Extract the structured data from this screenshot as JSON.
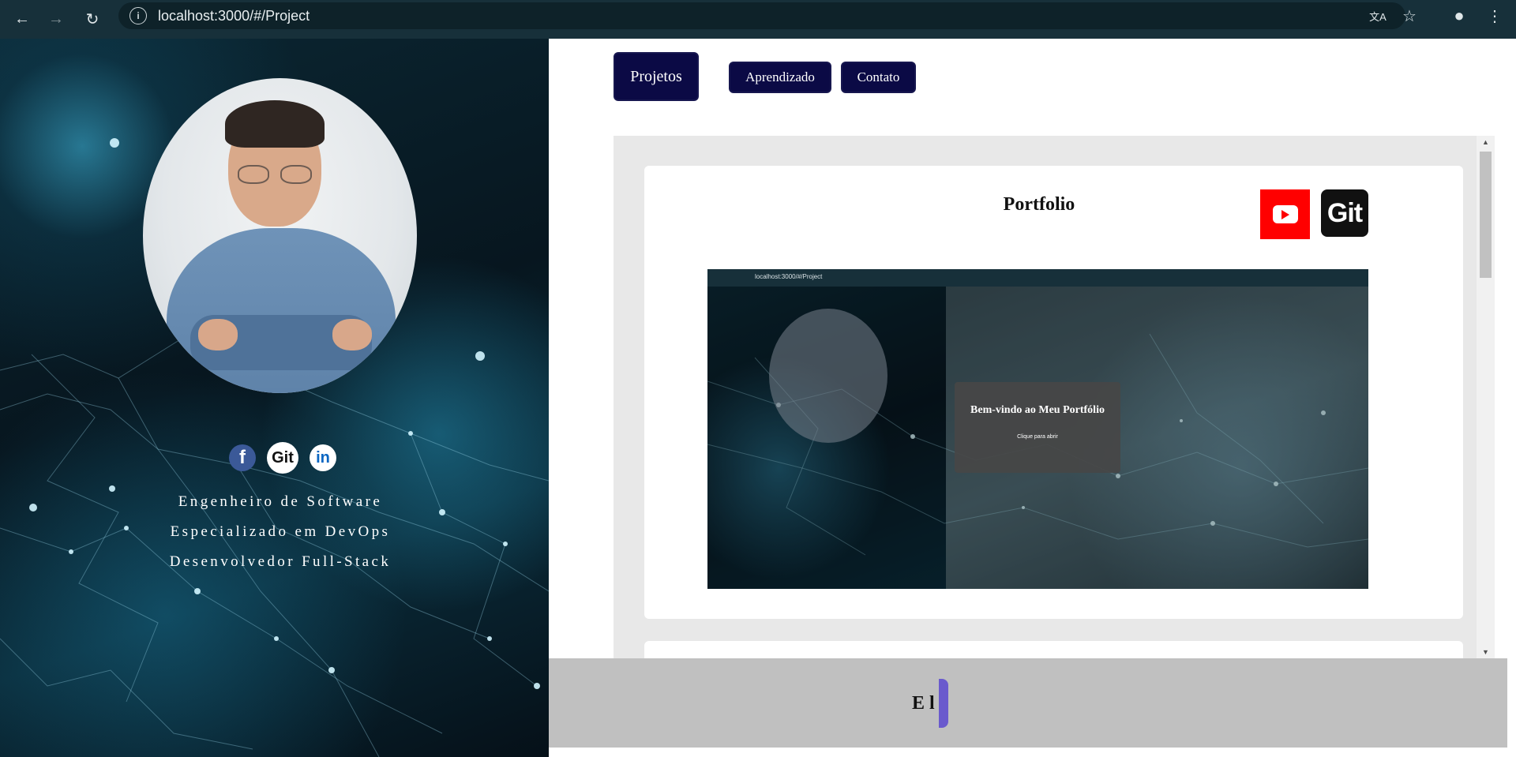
{
  "browser": {
    "back_icon": "←",
    "forward_icon": "→",
    "reload_icon": "↻",
    "url": "localhost:3000/#/Project",
    "translate_icon": "文A",
    "bookmark_icon": "☆",
    "profile_icon": "●",
    "menu_icon": "⋮"
  },
  "profile": {
    "socials": {
      "facebook": "f",
      "git": "Git",
      "linkedin": "in"
    },
    "roles": [
      "Engenheiro de Software",
      "Especializado em DevOps",
      "Desenvolvedor Full-Stack"
    ]
  },
  "nav": {
    "projetos": "Projetos",
    "aprendizado": "Aprendizado",
    "contato": "Contato"
  },
  "project_card": {
    "title": "Portfolio",
    "git_label": "Git",
    "preview": {
      "url": "localhost:3000/#/Project",
      "welcome_title": "Bem-vindo ao Meu Portfólio",
      "welcome_cta": "Clique para abrir"
    }
  },
  "footer": {
    "typed_text": "E l"
  },
  "colors": {
    "nav_button_bg": "#0b0a45",
    "youtube_red": "#ff0000",
    "footer_bg": "#c0c0c0",
    "cursor": "#6a5acd"
  }
}
